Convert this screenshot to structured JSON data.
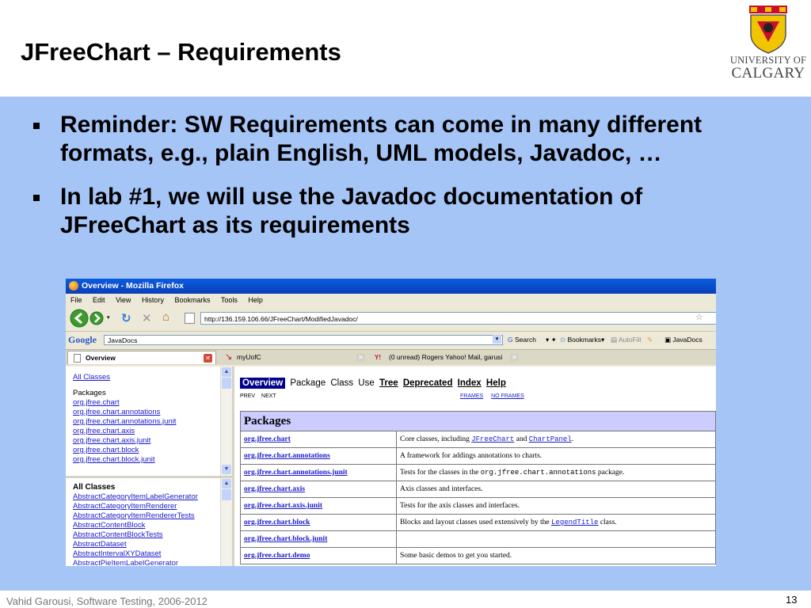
{
  "slide": {
    "title": "JFreeChart – Requirements",
    "logo": {
      "line1": "UNIVERSITY OF",
      "line2": "CALGARY"
    },
    "bullets": [
      "Reminder: SW Requirements can come in many different formats, e.g., plain English, UML models, Javadoc, …",
      "In lab #1, we will use the Javadoc documentation of JFreeChart as its requirements"
    ],
    "footer": "Vahid Garousi, Software Testing, 2006-2012",
    "page_number": "13"
  },
  "browser": {
    "window_title": "Overview - Mozilla Firefox",
    "menu": [
      "File",
      "Edit",
      "View",
      "History",
      "Bookmarks",
      "Tools",
      "Help"
    ],
    "url": "http://136.159.106.66/JFreeChart/ModifiedJavadoc/",
    "google": {
      "brand": "Google",
      "query": "JavaDocs",
      "search_label": "Search",
      "bookmarks_label": "Bookmarks",
      "autofill_label": "AutoFill",
      "javadocs_label": "JavaDocs"
    },
    "tabs": [
      {
        "label": "Overview",
        "active": true
      },
      {
        "label": "myUofC",
        "active": false
      },
      {
        "label": "(0 unread) Rogers Yahoo! Mail, garusi",
        "active": false
      }
    ],
    "left_frame_top": {
      "all_classes": "All Classes",
      "packages_heading": "Packages",
      "packages": [
        "org.jfree.chart",
        "org.jfree.chart.annotations",
        "org.jfree.chart.annotations.junit",
        "org.jfree.chart.axis",
        "org.jfree.chart.axis.junit",
        "org.jfree.chart.block",
        "org.jfree.chart.block.junit"
      ]
    },
    "left_frame_bottom": {
      "heading": "All Classes",
      "classes": [
        "AbstractCategoryItemLabelGenerator",
        "AbstractCategoryItemRenderer",
        "AbstractCategoryItemRendererTests",
        "AbstractContentBlock",
        "AbstractContentBlockTests",
        "AbstractDataset",
        "AbstractIntervalXYDataset",
        "AbstractPieItemLabelGenerator"
      ]
    },
    "doc_nav": {
      "current": "Overview",
      "items": [
        "Package",
        "Class",
        "Use"
      ],
      "links": [
        "Tree",
        "Deprecated",
        "Index",
        "Help"
      ],
      "prev": "PREV",
      "next": "NEXT",
      "frames": "FRAMES",
      "no_frames": "NO FRAMES"
    },
    "packages_table": {
      "heading": "Packages",
      "rows": [
        {
          "name": "org.jfree.chart",
          "parts": [
            {
              "t": "Core classes, including "
            },
            {
              "c": "JFreeChart"
            },
            {
              "t": " and "
            },
            {
              "c": "ChartPanel"
            },
            {
              "t": "."
            }
          ]
        },
        {
          "name": "org.jfree.chart.annotations",
          "parts": [
            {
              "t": "A framework for addings annotations to charts."
            }
          ]
        },
        {
          "name": "org.jfree.chart.annotations.junit",
          "parts": [
            {
              "t": "Tests for the classes in the "
            },
            {
              "m": "org.jfree.chart.annotations"
            },
            {
              "t": " package."
            }
          ]
        },
        {
          "name": "org.jfree.chart.axis",
          "parts": [
            {
              "t": "Axis classes and interfaces."
            }
          ]
        },
        {
          "name": "org.jfree.chart.axis.junit",
          "parts": [
            {
              "t": "Tests for the axis classes and interfaces."
            }
          ]
        },
        {
          "name": "org.jfree.chart.block",
          "parts": [
            {
              "t": "Blocks and layout classes used extensively by the "
            },
            {
              "c": "LegendTitle"
            },
            {
              "t": " class."
            }
          ]
        },
        {
          "name": "org.jfree.chart.block.junit",
          "parts": []
        },
        {
          "name": "org.jfree.chart.demo",
          "parts": [
            {
              "t": "Some basic demos to get you started."
            }
          ]
        }
      ]
    }
  },
  "colors": {
    "content_bg": "#a6c5f7",
    "table_header_bg": "#ccccff",
    "link": "#1a1acc",
    "nav_current_bg": "#00008b"
  }
}
